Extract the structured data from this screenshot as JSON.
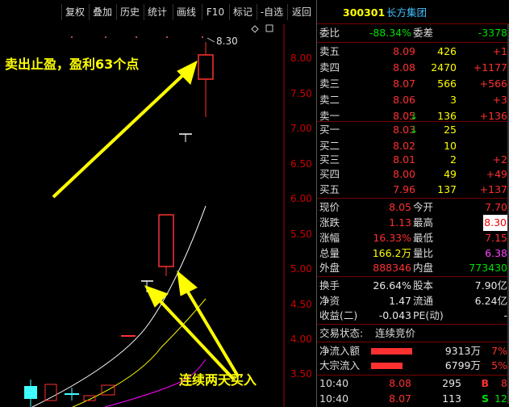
{
  "toolbar": {
    "items": [
      "复权",
      "叠加",
      "历史",
      "统计",
      "画线",
      "F10",
      "标记",
      "-自选",
      "返回"
    ]
  },
  "chart": {
    "y_labels": [
      "8.00",
      "7.50",
      "7.00",
      "6.50",
      "6.00",
      "5.50",
      "5.00",
      "4.50",
      "4.00",
      "3.50"
    ],
    "high_label": "8.30",
    "annotation_top": "卖出止盈，盈利63个点",
    "annotation_bottom": "连续两天买入"
  },
  "stock": {
    "code": "300301",
    "name": "长方集团"
  },
  "weibi": {
    "label": "委比",
    "value": "-88.34%",
    "diff_label": "委差",
    "diff": "-3378"
  },
  "sell": [
    {
      "label": "卖五",
      "price": "8.09",
      "vol": "426",
      "chg": "+1"
    },
    {
      "label": "卖四",
      "price": "8.08",
      "vol": "2470",
      "chg": "+1177"
    },
    {
      "label": "卖三",
      "price": "8.07",
      "vol": "566",
      "chg": "+566"
    },
    {
      "label": "卖二",
      "price": "8.06",
      "vol": "3",
      "chg": "+3"
    },
    {
      "label": "卖一",
      "price": "8.05",
      "vol": "136",
      "chg": "+136"
    }
  ],
  "buy": [
    {
      "label": "买一",
      "price": "8.03",
      "vol": "25",
      "chg": ""
    },
    {
      "label": "买二",
      "price": "8.02",
      "vol": "10",
      "chg": ""
    },
    {
      "label": "买三",
      "price": "8.01",
      "vol": "2",
      "chg": "+2"
    },
    {
      "label": "买四",
      "price": "8.00",
      "vol": "49",
      "chg": "+49"
    },
    {
      "label": "买五",
      "price": "7.96",
      "vol": "137",
      "chg": "+137"
    }
  ],
  "quote": [
    {
      "l1": "现价",
      "v1": "8.05",
      "l2": "今开",
      "v2": "7.70"
    },
    {
      "l1": "涨跌",
      "v1": "1.13",
      "l2": "最高",
      "v2": "8.30"
    },
    {
      "l1": "涨幅",
      "v1": "16.33%",
      "l2": "最低",
      "v2": "7.15"
    },
    {
      "l1": "总量",
      "v1": "166.2万",
      "l2": "量比",
      "v2": "6.38"
    },
    {
      "l1": "外盘",
      "v1": "888346",
      "l2": "内盘",
      "v2": "773430"
    }
  ],
  "finance": [
    {
      "l1": "换手",
      "v1": "26.64%",
      "l2": "股本",
      "v2": "7.90亿"
    },
    {
      "l1": "净资",
      "v1": "1.47",
      "l2": "流通",
      "v2": "6.24亿"
    },
    {
      "l1": "收益(二)",
      "v1": "-0.043",
      "l2": "PE(动)",
      "v2": "-"
    }
  ],
  "trade_status": {
    "label": "交易状态:",
    "value": "连续竞价"
  },
  "flows": [
    {
      "label": "净流入额",
      "amount": "9313万",
      "pct": "7%",
      "bar": 0.85
    },
    {
      "label": "大宗流入",
      "amount": "6799万",
      "pct": "5%",
      "bar": 0.65
    }
  ],
  "ticks": [
    {
      "time": "10:40",
      "price": "8.08",
      "vol": "295",
      "side": "B",
      "num": "8"
    },
    {
      "time": "10:40",
      "price": "8.07",
      "vol": "113",
      "side": "S",
      "num": "12"
    }
  ],
  "colors": {
    "up": "#ff3030",
    "down": "#00e000",
    "accent": "#ffff00"
  }
}
